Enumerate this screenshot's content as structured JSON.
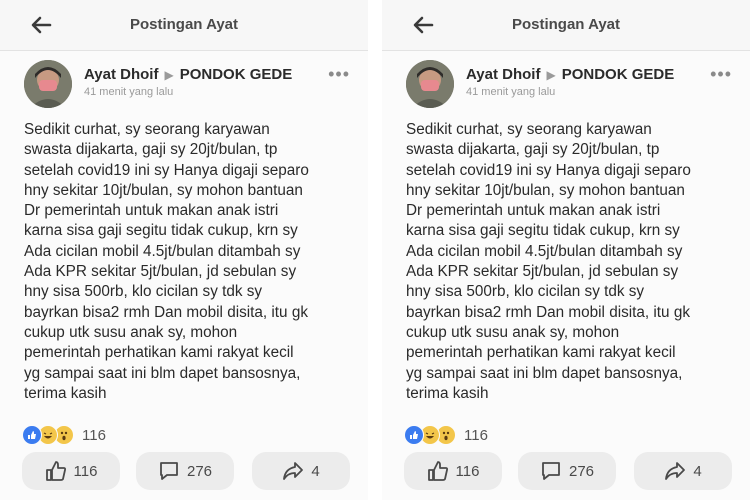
{
  "header": {
    "title": "Postingan Ayat"
  },
  "post": {
    "author": "Ayat Dhoif",
    "group": "PONDOK GEDE",
    "time": "41 menit yang lalu",
    "lines": [
      "Sedikit curhat, sy seorang karyawan",
      "swasta dijakarta, gaji sy 20jt/bulan, tp",
      "setelah covid19 ini sy Hanya digaji separo",
      "hny sekitar 10jt/bulan, sy mohon bantuan",
      "Dr pemerintah untuk makan anak istri",
      "karna sisa gaji segitu tidak cukup, krn sy",
      "Ada cicilan mobil 4.5jt/bulan ditambah sy",
      "Ada KPR sekitar 5jt/bulan, jd sebulan sy",
      "hny sisa 500rb, klo cicilan sy tdk sy",
      "bayrkan bisa2 rmh Dan mobil disita, itu gk",
      "cukup utk susu anak sy, mohon",
      "pemerintah perhatikan kami rakyat kecil",
      "yg sampai saat ini blm dapet bansosnya,",
      "terima kasih"
    ],
    "reaction_total": "116"
  },
  "actions": {
    "likes": "116",
    "comments": "276",
    "shares": "4"
  },
  "colors": {
    "like_blue": "#3b7cf0",
    "haha_yellow": "#f3c64a"
  },
  "icons": [
    "back-arrow-icon",
    "more-dots-icon",
    "like-reaction-icon",
    "haha-reaction-icon",
    "wow-reaction-icon",
    "thumbs-up-icon",
    "comment-icon",
    "share-icon"
  ]
}
